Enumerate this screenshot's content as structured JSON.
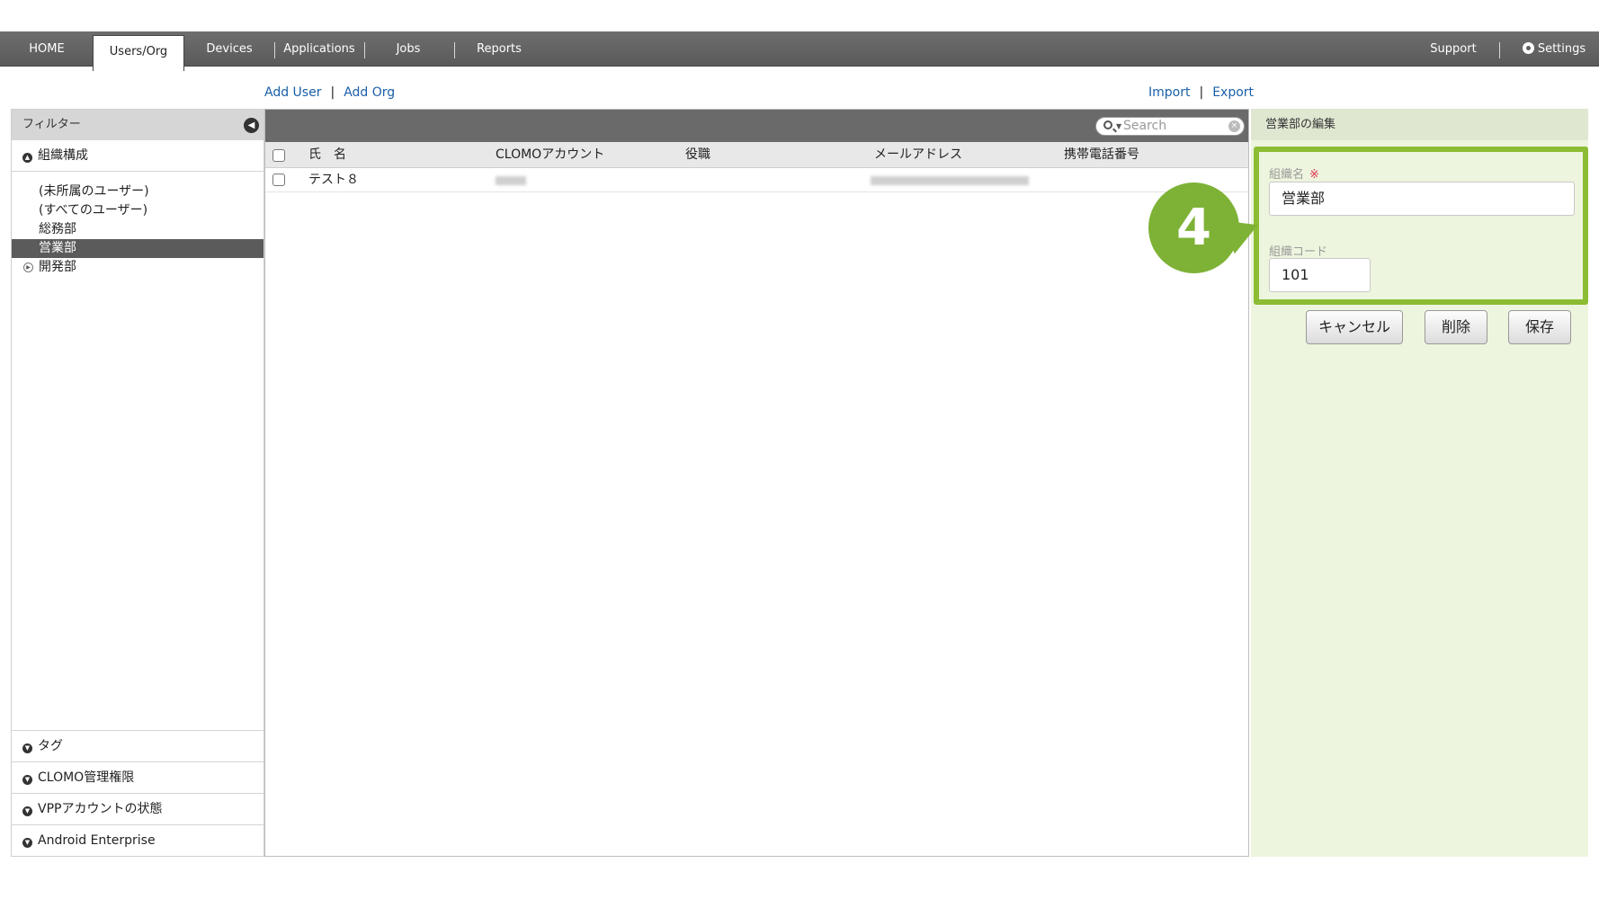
{
  "nav": {
    "tabs": [
      "HOME",
      "Users/Org",
      "Devices",
      "Applications",
      "Jobs",
      "Reports"
    ],
    "right": [
      "Support",
      "Settings"
    ]
  },
  "actions": {
    "add_user": "Add User",
    "add_org": "Add Org",
    "import": "Import",
    "export": "Export",
    "separator": "|"
  },
  "sidebar": {
    "filter_title": "フィルター",
    "org_section": "組織構成",
    "tree": [
      "(未所属のユーザー)",
      "(すべてのユーザー)",
      "総務部",
      "営業部",
      "開発部"
    ],
    "bottom_sections": [
      "タグ",
      "CLOMO管理権限",
      "VPPアカウントの状態",
      "Android Enterprise"
    ]
  },
  "table": {
    "search_placeholder": "Search",
    "columns": [
      "氏　名",
      "CLOMOアカウント",
      "役職",
      "メールアドレス",
      "携帯電話番号"
    ],
    "rows": [
      {
        "name": "テスト８"
      }
    ]
  },
  "edit_panel": {
    "title": "営業部の編集",
    "org_name_label": "組織名",
    "required_mark": "※",
    "org_name_value": "営業部",
    "org_code_label": "組織コード",
    "org_code_value": "101",
    "cancel": "キャンセル",
    "delete": "削除",
    "save": "保存"
  },
  "callout": {
    "number": "4",
    "color": "#7eb236"
  },
  "colors": {
    "nav_bg": "#5f5f5f",
    "link": "#1a5fa8",
    "accent_green": "#8cbc33",
    "panel_bg": "#edf5de"
  }
}
